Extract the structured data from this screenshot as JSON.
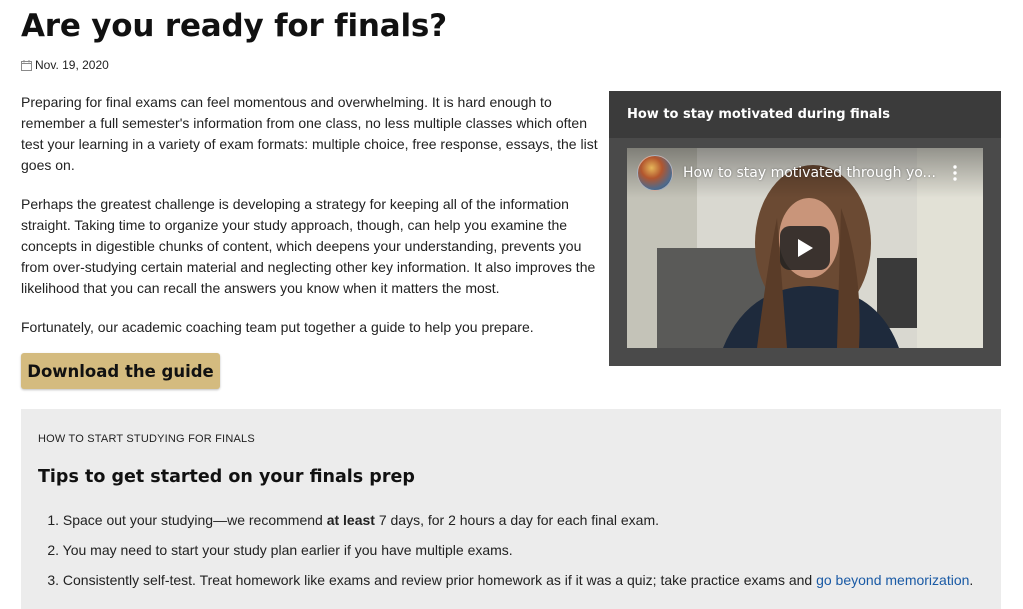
{
  "page": {
    "title": "Are you ready for finals?",
    "date": "Nov. 19, 2020",
    "calendar_icon": "calendar-icon"
  },
  "article": {
    "paragraphs": [
      "Preparing for final exams can feel momentous and overwhelming. It is hard enough to remember a full semester's information from one class, no less multiple classes which often test your learning in a variety of exam formats: multiple choice, free response, essays, the list goes on.",
      "Perhaps the greatest challenge is developing a strategy for keeping all of the information straight. Taking time to organize your study approach, though, can help you examine the concepts in digestible chunks of content, which deepens your understanding, prevents you from over-studying certain material and neglecting other key information. It also improves the likelihood that you can recall the answers you know when it matters the most.",
      "Fortunately, our academic coaching team put together a guide to help you prepare."
    ],
    "download_button": "Download the guide"
  },
  "video_panel": {
    "heading": "How to stay motivated during finals",
    "video_title": "How to stay motivated through yo...",
    "play_icon": "play-icon",
    "more_icon": "more-vertical-icon"
  },
  "tips": {
    "eyebrow": "HOW TO START STUDYING FOR FINALS",
    "heading": "Tips to get started on your finals prep",
    "items": [
      {
        "number": "1.",
        "before": "Space out your studying—we recommend ",
        "bold": "at least",
        "after": " 7 days, for 2 hours a day for each final exam."
      },
      {
        "number": "2.",
        "text": "You may need to start your study plan earlier if you have multiple exams."
      },
      {
        "number": "3.",
        "before": "Consistently self-test. Treat homework like exams and review prior homework as if it was a quiz; take practice exams and ",
        "link": "go beyond memorization",
        "after": "."
      }
    ]
  },
  "colors": {
    "button_bg": "#d4bb7f",
    "panel_bg": "#4a4a4a",
    "panel_header_bg": "#3b3b3b",
    "tips_bg": "#ececec",
    "link": "#1a5aa5"
  }
}
